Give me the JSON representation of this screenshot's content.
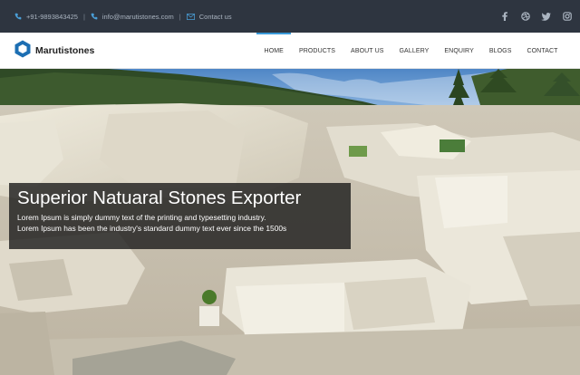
{
  "topbar": {
    "phone": "+91-9893843425",
    "email": "info@marutistones.com",
    "contact_link": "Contact us",
    "social": [
      "facebook-icon",
      "dribbble-icon",
      "twitter-icon",
      "instagram-icon"
    ]
  },
  "brand": {
    "name": "Marutistones"
  },
  "nav": {
    "items": [
      "HOME",
      "PRODUCTS",
      "ABOUT US",
      "GALLERY",
      "ENQUIRY",
      "BLOGS",
      "CONTACT"
    ],
    "active": "HOME"
  },
  "hero": {
    "title": "Superior Natuaral Stones Exporter",
    "line1": "Lorem Ipsum is simply dummy text of the printing and typesetting industry.",
    "line2": "Lorem Ipsum has been the industry's standard dummy text ever since the 1500s"
  },
  "colors": {
    "topbar_bg": "#2e3540",
    "accent": "#3a9ad9",
    "caption_bg": "#1a1a1a"
  }
}
